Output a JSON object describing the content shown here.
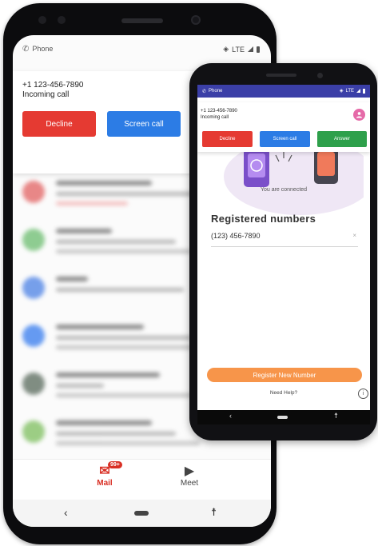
{
  "phone_large": {
    "status": {
      "app": "Phone",
      "network": "LTE"
    },
    "call": {
      "number": "+1 123-456-7890",
      "label": "Incoming call",
      "decline": "Decline",
      "screen": "Screen call"
    },
    "bottom_nav": {
      "mail": "Mail",
      "mail_badge": "99+",
      "meet": "Meet"
    }
  },
  "phone_small": {
    "status": {
      "app": "Phone",
      "network": "LTE"
    },
    "call": {
      "number": "+1 123-456-7890",
      "label": "Incoming call",
      "decline": "Decline",
      "screen": "Screen call",
      "answer": "Answer"
    },
    "connected": "You are connected",
    "registered": {
      "title": "Registered numbers",
      "items": [
        "(123) 456-7890"
      ],
      "remove": "×"
    },
    "register_button": "Register New Number",
    "help": "Need Help?",
    "info": "i"
  },
  "colors": {
    "decline": "#e53a32",
    "screen": "#2c7ce5",
    "answer": "#2ea04b",
    "status_bar": "#3b3fa7",
    "register": "#f7954a",
    "mail_red": "#d93025"
  }
}
